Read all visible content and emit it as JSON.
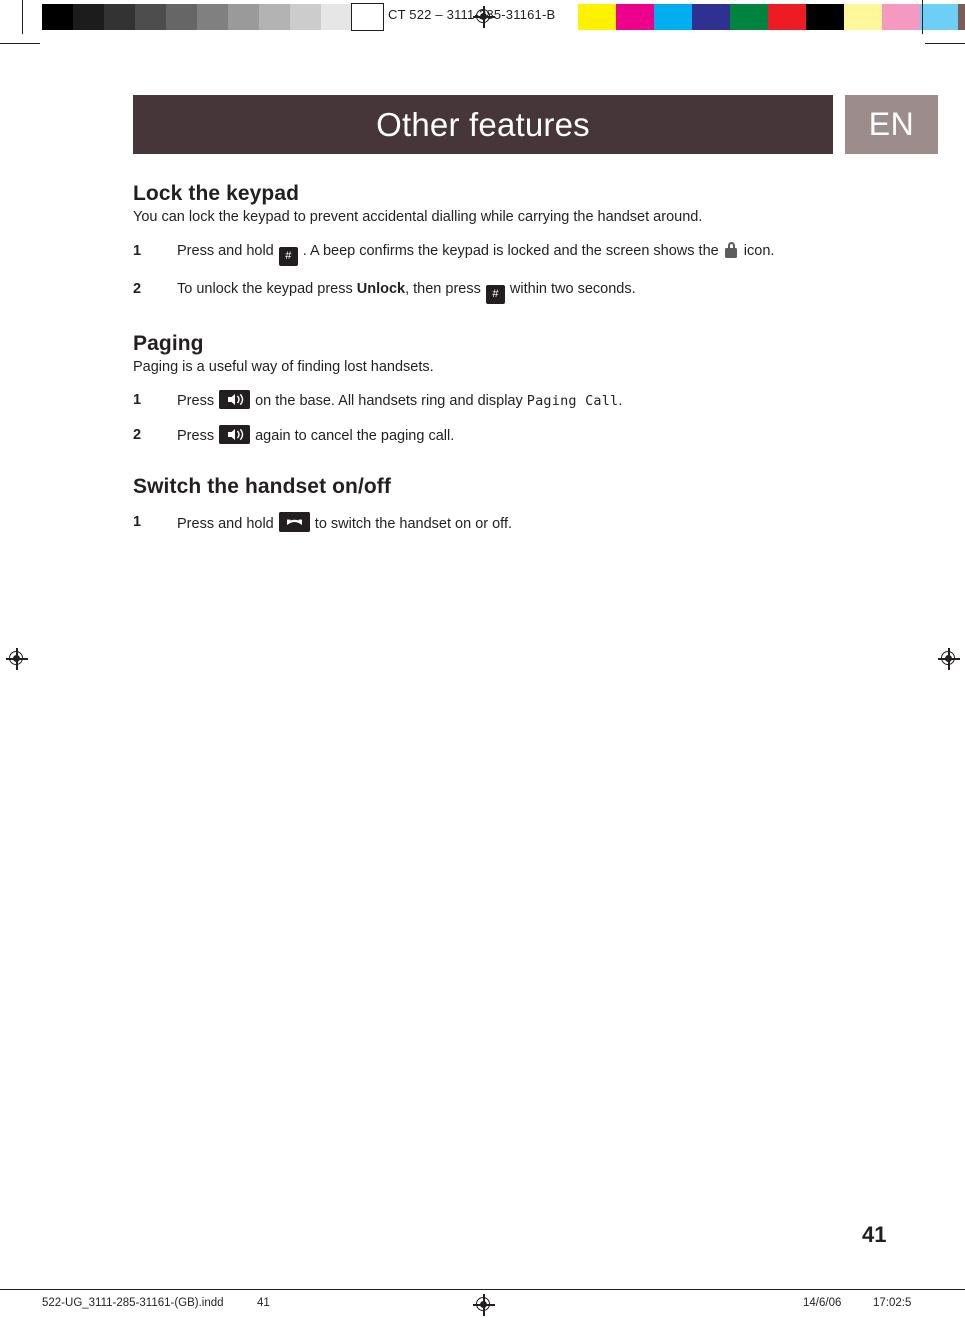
{
  "print_strip": {
    "label": "CT 522  –   3111-285-31161-B",
    "grey_swatches": [
      "#000000",
      "#1c1c1c",
      "#333333",
      "#4d4d4d",
      "#666666",
      "#808080",
      "#9a9a9a",
      "#b3b3b3",
      "#cccccc",
      "#e6e6e6",
      "#ffffff"
    ],
    "color_swatches": [
      "#fff200",
      "#ec008c",
      "#00aeef",
      "#2e3192",
      "#00833e",
      "#ed1c24",
      "#000000",
      "#fff799",
      "#f49ac1",
      "#6dcff6",
      "#7a5c58"
    ],
    "registration_icon": "registration-target-icon"
  },
  "header": {
    "title": "Other features",
    "language": "EN",
    "band_color": "#463539",
    "language_band_color": "#9c8d8c"
  },
  "sections": [
    {
      "heading": "Lock the keypad",
      "intro": "You can lock the keypad to prevent accidental dialling while carrying the handset around.",
      "steps": [
        {
          "num": "1",
          "parts": [
            {
              "type": "text",
              "value": "Press and hold "
            },
            {
              "type": "key",
              "style": "hash",
              "value": "#",
              "name": "hash-key-icon"
            },
            {
              "type": "text",
              "value": " . A beep confirms the keypad is locked and the screen shows the "
            },
            {
              "type": "icon",
              "name": "keypad-lock-icon"
            },
            {
              "type": "text",
              "value": " icon."
            }
          ]
        },
        {
          "num": "2",
          "parts": [
            {
              "type": "text",
              "value": "To unlock the keypad press "
            },
            {
              "type": "bold",
              "value": "Unlock"
            },
            {
              "type": "text",
              "value": ", then press "
            },
            {
              "type": "key",
              "style": "hash",
              "value": "#",
              "name": "hash-key-icon"
            },
            {
              "type": "text",
              "value": " within two seconds."
            }
          ]
        }
      ]
    },
    {
      "heading": "Paging",
      "intro": "Paging is a useful way of finding lost handsets.",
      "steps": [
        {
          "num": "1",
          "parts": [
            {
              "type": "text",
              "value": "Press "
            },
            {
              "type": "key",
              "style": "page",
              "value": "•)))",
              "name": "paging-key-icon"
            },
            {
              "type": "text",
              "value": " on the base. All handsets ring and display "
            },
            {
              "type": "mono",
              "value": "Paging Call"
            },
            {
              "type": "text",
              "value": "."
            }
          ]
        },
        {
          "num": "2",
          "parts": [
            {
              "type": "text",
              "value": "Press "
            },
            {
              "type": "key",
              "style": "page",
              "value": "•)))",
              "name": "paging-key-icon"
            },
            {
              "type": "text",
              "value": " again to cancel the paging call."
            }
          ]
        }
      ]
    },
    {
      "heading": "Switch the handset on/off",
      "intro": "",
      "steps": [
        {
          "num": "1",
          "parts": [
            {
              "type": "text",
              "value": "Press and hold "
            },
            {
              "type": "key",
              "style": "power",
              "value": "☎",
              "name": "hangup-power-key-icon"
            },
            {
              "type": "text",
              "value": " to switch the handset on or off."
            }
          ]
        }
      ]
    }
  ],
  "page_number": "41",
  "footer": {
    "filename": "522-UG_3111-285-31161-(GB).indd",
    "page": "41",
    "date": "14/6/06",
    "time": "17:02:5"
  }
}
